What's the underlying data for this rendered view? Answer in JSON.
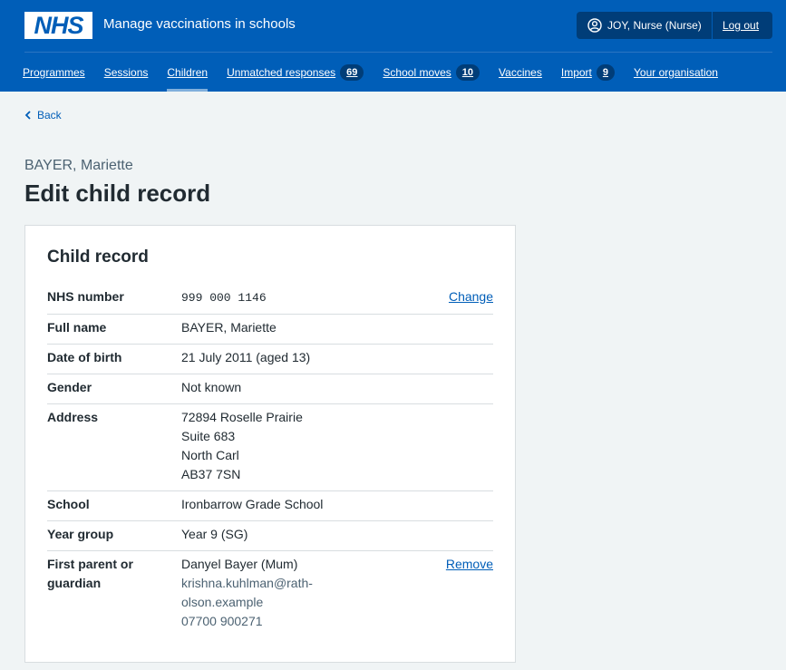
{
  "header": {
    "logo_text": "NHS",
    "service_name": "Manage vaccinations in schools",
    "user_label": "JOY, Nurse (Nurse)",
    "logout_label": "Log out"
  },
  "nav": [
    {
      "label": "Programmes",
      "badge": null,
      "active": false
    },
    {
      "label": "Sessions",
      "badge": null,
      "active": false
    },
    {
      "label": "Children",
      "badge": null,
      "active": true
    },
    {
      "label": "Unmatched responses",
      "badge": "69",
      "active": false
    },
    {
      "label": "School moves",
      "badge": "10",
      "active": false
    },
    {
      "label": "Vaccines",
      "badge": null,
      "active": false
    },
    {
      "label": "Import",
      "badge": "9",
      "active": false
    },
    {
      "label": "Your organisation",
      "badge": null,
      "active": false
    }
  ],
  "back_label": "Back",
  "caption": "BAYER, Mariette",
  "page_title": "Edit child record",
  "card": {
    "title": "Child record",
    "rows": {
      "nhs": {
        "key": "NHS number",
        "value": "999 000 1146",
        "action": "Change"
      },
      "name": {
        "key": "Full name",
        "value": "BAYER, Mariette"
      },
      "dob": {
        "key": "Date of birth",
        "value": "21 July 2011 (aged 13)"
      },
      "gender": {
        "key": "Gender",
        "value": "Not known"
      },
      "address": {
        "key": "Address",
        "lines": [
          "72894 Roselle Prairie",
          "Suite 683",
          "North Carl",
          "AB37 7SN"
        ]
      },
      "school": {
        "key": "School",
        "value": "Ironbarrow Grade School"
      },
      "year": {
        "key": "Year group",
        "value": "Year 9 (SG)"
      },
      "parent": {
        "key_line1": "First parent or",
        "key_line2": "guardian",
        "name": "Danyel Bayer (Mum)",
        "email_line1": "krishna.kuhlman@rath-",
        "email_line2": "olson.example",
        "phone": "07700 900271",
        "action": "Remove"
      }
    }
  },
  "colors": {
    "brand": "#005eb8",
    "brand_dark": "#003d78",
    "background": "#f0f4f5"
  }
}
